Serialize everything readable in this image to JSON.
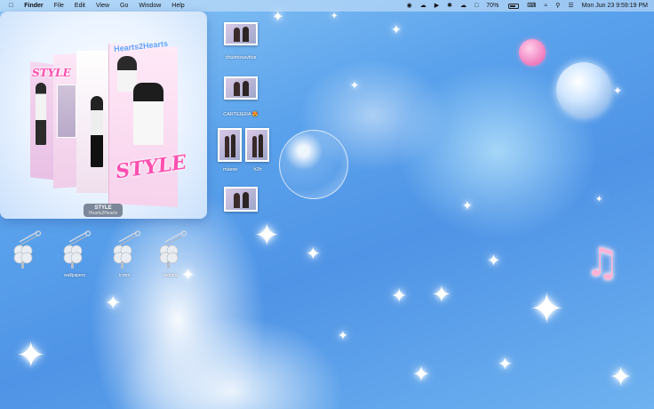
{
  "menubar": {
    "apple_icon": "apple-icon",
    "app_name": "Finder",
    "menus": [
      "File",
      "Edit",
      "View",
      "Go",
      "Window",
      "Help"
    ],
    "battery_percent": "70%",
    "datetime": "Mon Jun 23  9:59:19 PM"
  },
  "preview": {
    "album_name": "STYLE",
    "artist": "Hearts2Hearts",
    "logo_text": "STYLE",
    "group_logo": "Hearts2Hearts"
  },
  "desktop_items": [
    {
      "caption": "chuimosavitus"
    },
    {
      "caption": "CARTEIERA 😍"
    },
    {
      "caption": "miaow"
    },
    {
      "caption": "h2h"
    },
    {
      "caption": ""
    }
  ],
  "pin_icons": [
    {
      "caption": ""
    },
    {
      "caption": "wallpapers"
    },
    {
      "caption": "icons"
    },
    {
      "caption": "widgets"
    }
  ],
  "colors": {
    "accent_pink": "#ff4fb0",
    "background_blue": "#4f94e6"
  }
}
